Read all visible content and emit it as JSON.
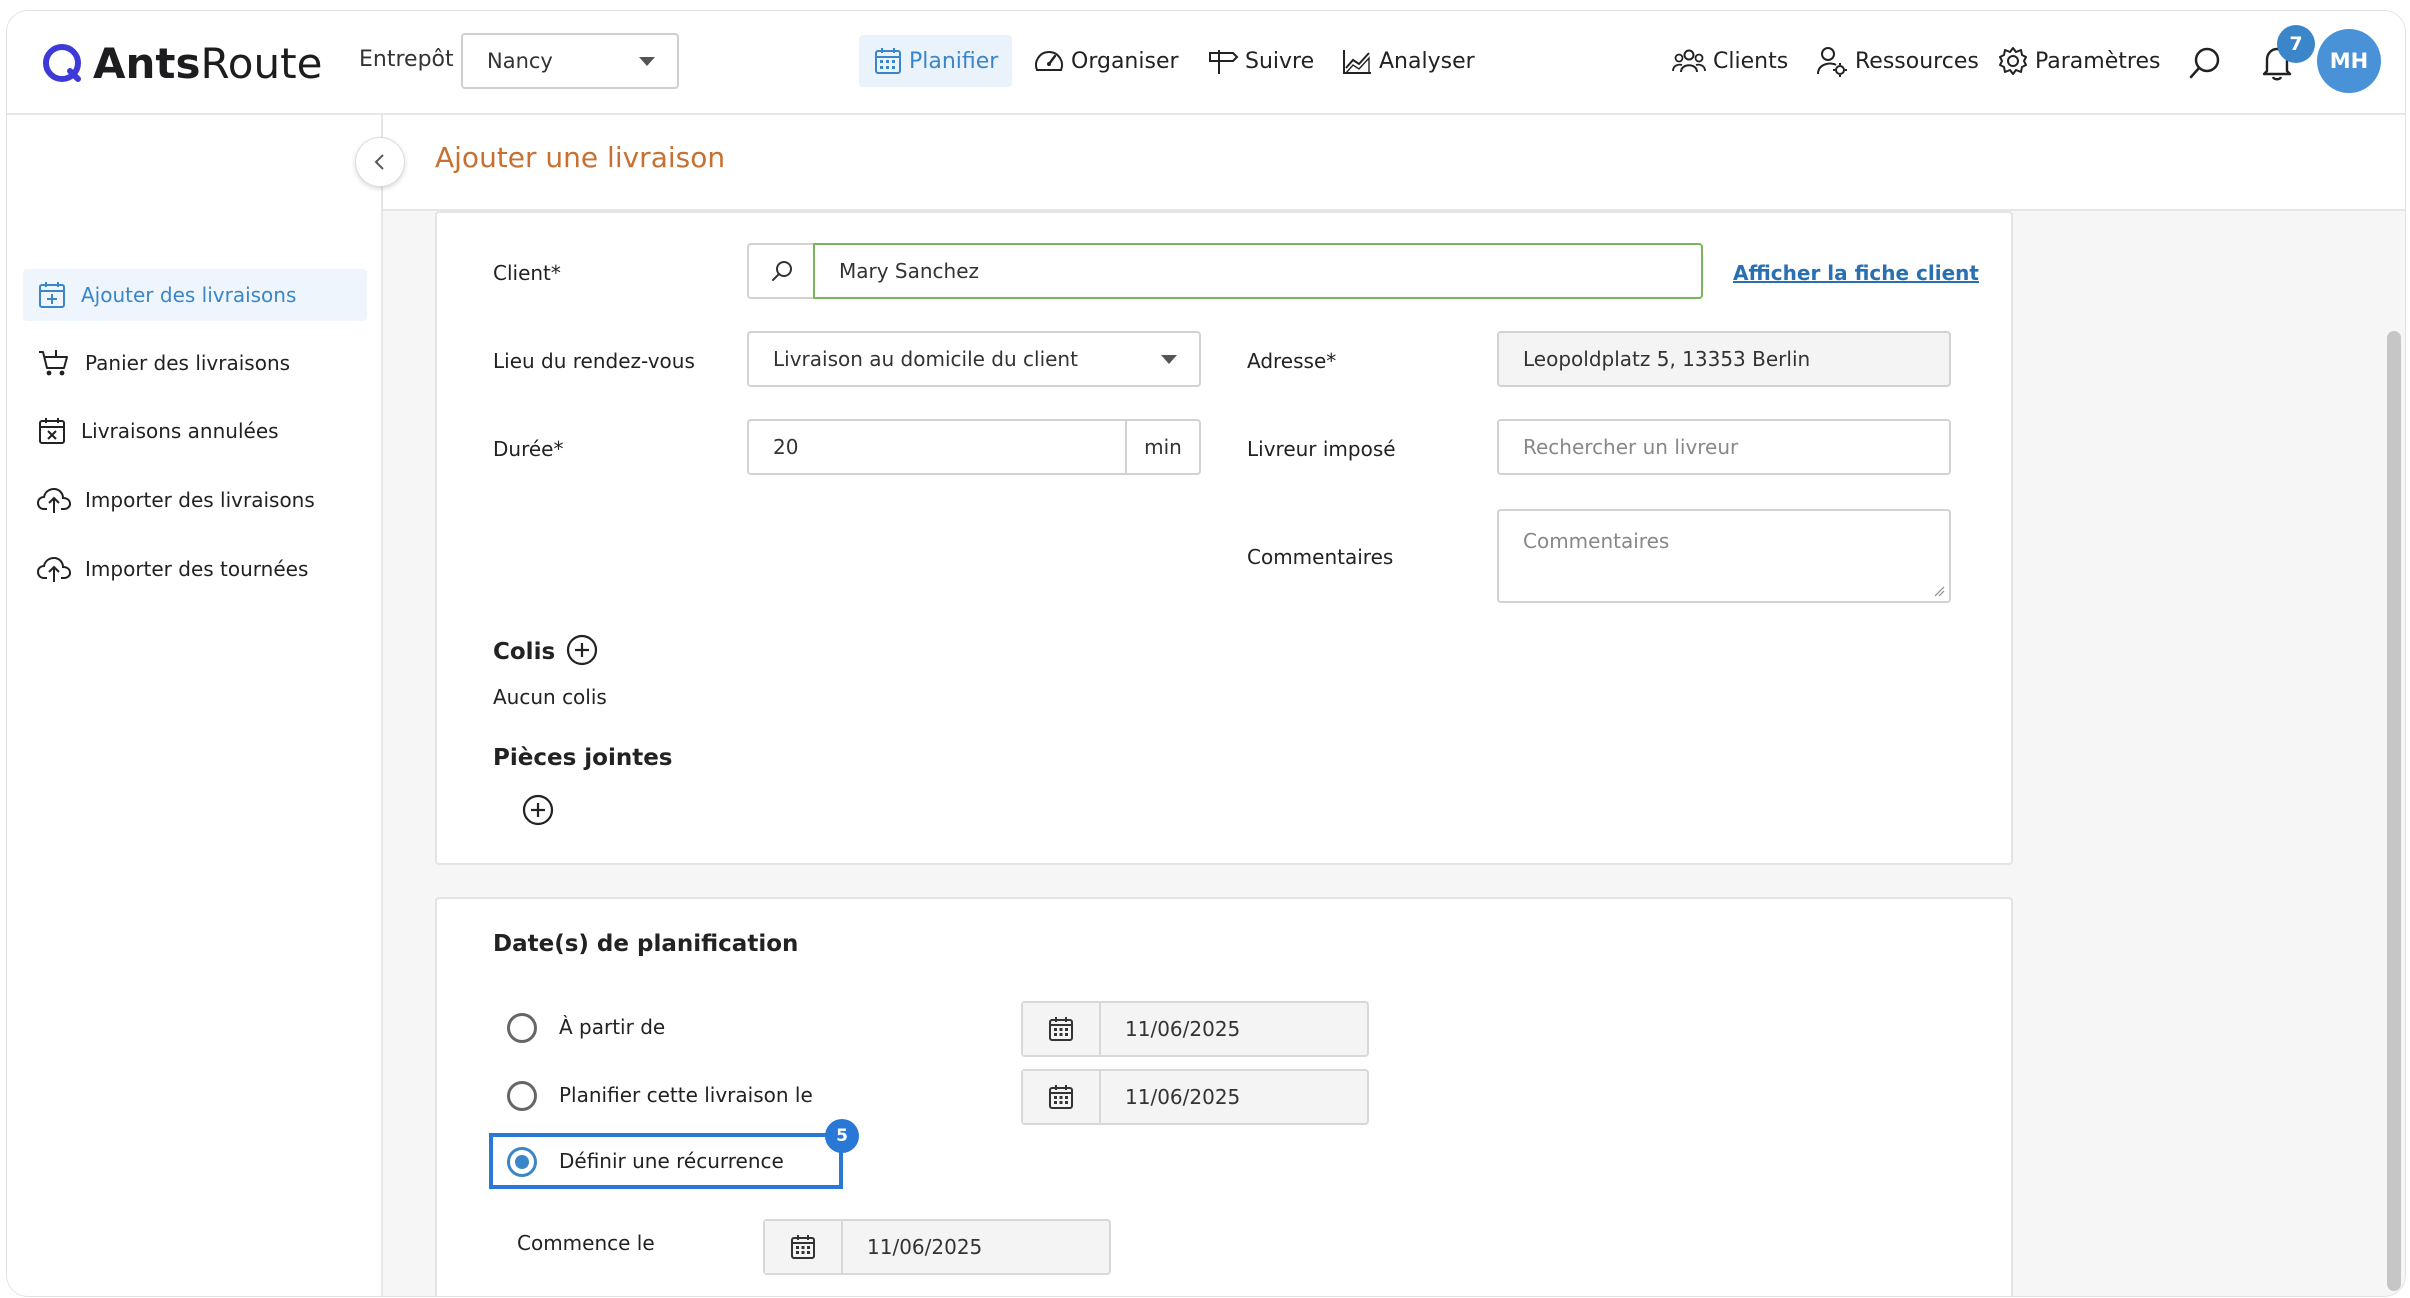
{
  "header": {
    "logo_bold": "Ants",
    "logo_light": "Route",
    "warehouse_label": "Entrepôt",
    "warehouse_value": "Nancy",
    "nav": {
      "plan": "Planifier",
      "organize": "Organiser",
      "track": "Suivre",
      "analyze": "Analyser",
      "clients": "Clients",
      "resources": "Ressources",
      "settings": "Paramètres"
    },
    "notification_count": "7",
    "avatar_initials": "MH",
    "accent_color": "#3a86c8"
  },
  "sidebar": {
    "items": [
      {
        "label": "Ajouter des livraisons",
        "active": true
      },
      {
        "label": "Panier des livraisons"
      },
      {
        "label": "Livraisons annulées"
      },
      {
        "label": "Importer des livraisons"
      },
      {
        "label": "Importer des tournées"
      }
    ]
  },
  "page": {
    "title": "Ajouter une livraison",
    "title_color": "#c8702f"
  },
  "form": {
    "client_label": "Client*",
    "client_value": "Mary Sanchez",
    "client_link": "Afficher la fiche client",
    "place_label": "Lieu du rendez-vous",
    "place_value": "Livraison au domicile du client",
    "address_label": "Adresse*",
    "address_value": "Leopoldplatz 5, 13353 Berlin",
    "duration_label": "Durée*",
    "duration_value": "20",
    "duration_unit": "min",
    "driver_label": "Livreur imposé",
    "driver_placeholder": "Rechercher un livreur",
    "comments_label": "Commentaires",
    "comments_placeholder": "Commentaires",
    "parcels_title": "Colis",
    "parcels_empty": "Aucun colis",
    "attachments_title": "Pièces jointes"
  },
  "scheduling": {
    "title": "Date(s) de planification",
    "options": [
      {
        "label": "À partir de",
        "date": "11/06/2025",
        "selected": false
      },
      {
        "label": "Planifier cette livraison le",
        "date": "11/06/2025",
        "selected": false
      },
      {
        "label": "Définir une récurrence",
        "selected": true
      }
    ],
    "step_badge": "5",
    "starts_label": "Commence le",
    "starts_date": "11/06/2025"
  }
}
